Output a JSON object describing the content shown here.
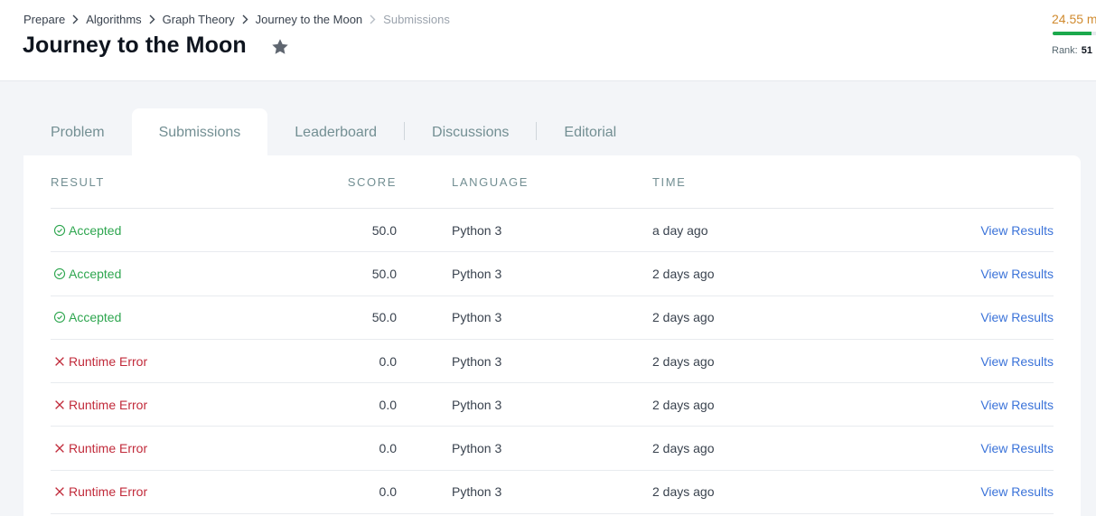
{
  "breadcrumb": {
    "items": [
      "Prepare",
      "Algorithms",
      "Graph Theory",
      "Journey to the Moon"
    ],
    "current": "Submissions"
  },
  "page": {
    "title": "Journey to the Moon"
  },
  "profile": {
    "points": "24.55 m",
    "rank_label": "Rank:",
    "rank_value": "51",
    "progress_fraction": 0.72
  },
  "tabs": [
    {
      "label": "Problem",
      "active": false
    },
    {
      "label": "Submissions",
      "active": true
    },
    {
      "label": "Leaderboard",
      "active": false
    },
    {
      "label": "Discussions",
      "active": false
    },
    {
      "label": "Editorial",
      "active": false
    }
  ],
  "table": {
    "columns": {
      "result": "RESULT",
      "score": "SCORE",
      "language": "LANGUAGE",
      "time": "TIME"
    },
    "rows": [
      {
        "result": "Accepted",
        "status": "accepted",
        "score": "50.0",
        "language": "Python 3",
        "time": "a day ago",
        "action": "View Results"
      },
      {
        "result": "Accepted",
        "status": "accepted",
        "score": "50.0",
        "language": "Python 3",
        "time": "2 days ago",
        "action": "View Results"
      },
      {
        "result": "Accepted",
        "status": "accepted",
        "score": "50.0",
        "language": "Python 3",
        "time": "2 days ago",
        "action": "View Results"
      },
      {
        "result": "Runtime Error",
        "status": "error",
        "score": "0.0",
        "language": "Python 3",
        "time": "2 days ago",
        "action": "View Results"
      },
      {
        "result": "Runtime Error",
        "status": "error",
        "score": "0.0",
        "language": "Python 3",
        "time": "2 days ago",
        "action": "View Results"
      },
      {
        "result": "Runtime Error",
        "status": "error",
        "score": "0.0",
        "language": "Python 3",
        "time": "2 days ago",
        "action": "View Results"
      },
      {
        "result": "Runtime Error",
        "status": "error",
        "score": "0.0",
        "language": "Python 3",
        "time": "2 days ago",
        "action": "View Results"
      }
    ]
  },
  "colors": {
    "accepted": "#2ea64f",
    "error": "#c12a3a",
    "link": "#3b73d9",
    "points": "#d08a2e",
    "progress": "#1ba94c"
  },
  "icons": {
    "accepted": "check-circle-icon",
    "error": "x-icon",
    "favorite": "star-icon",
    "separator": "chevron-right-icon"
  }
}
